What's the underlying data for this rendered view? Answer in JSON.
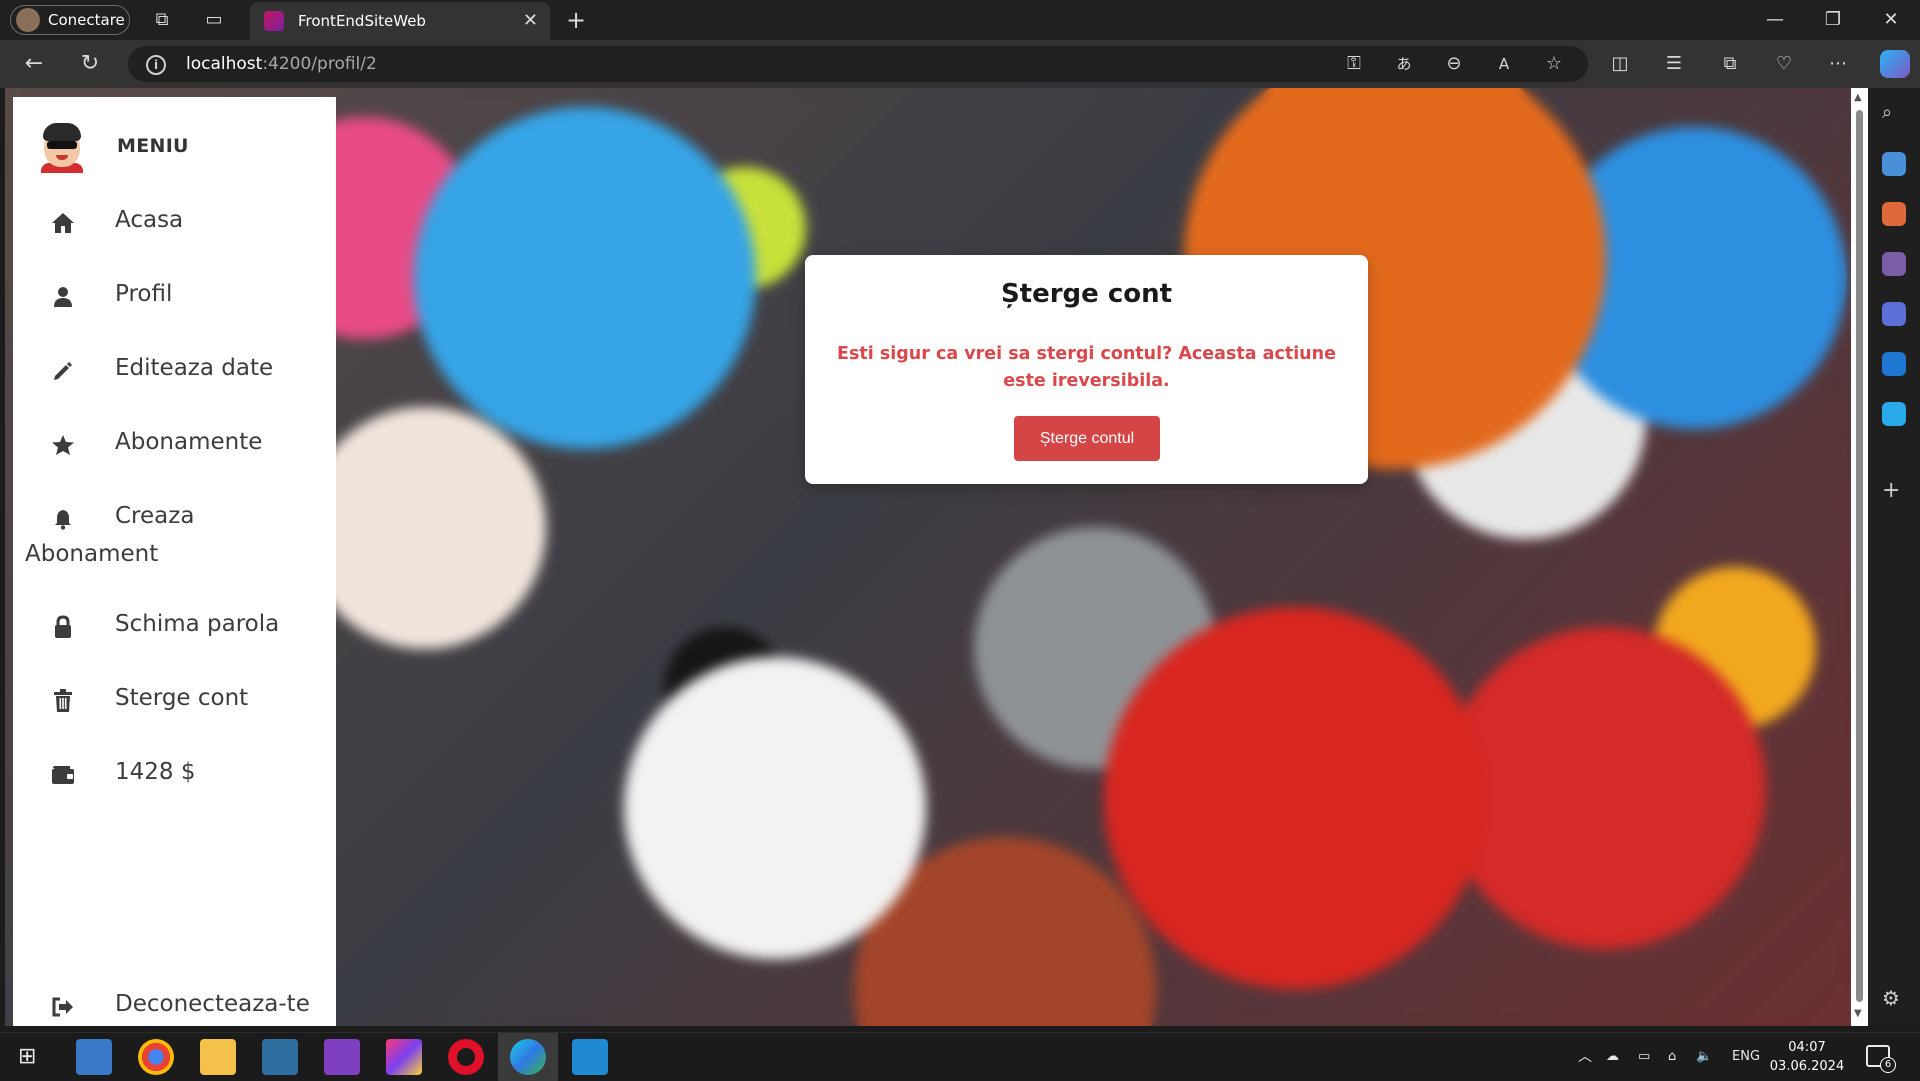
{
  "browser": {
    "profile_label": "Conectare",
    "tab_title": "FrontEndSiteWeb",
    "url_host": "localhost",
    "url_path": ":4200/profil/2"
  },
  "sidebar": {
    "title": "MENIU",
    "items": [
      {
        "label": "Acasa",
        "icon": "home-icon"
      },
      {
        "label": "Profil",
        "icon": "user-icon"
      },
      {
        "label": "Editeaza date",
        "icon": "pencil-icon"
      },
      {
        "label": "Abonamente",
        "icon": "star-icon"
      },
      {
        "label": "Creaza",
        "label2": "Abonament",
        "icon": "bell-icon"
      },
      {
        "label": "Schima parola",
        "icon": "lock-icon"
      },
      {
        "label": "Sterge cont",
        "icon": "trash-icon"
      },
      {
        "label": "1428 $",
        "icon": "wallet-icon"
      }
    ],
    "logout_label": "Deconecteaza-te"
  },
  "modal": {
    "title": "Șterge cont",
    "message": "Esti sigur ca vrei sa stergi contul? Aceasta actiune este ireversibila.",
    "button_label": "Șterge contul"
  },
  "taskbar": {
    "language": "ENG",
    "time": "04:07",
    "date": "03.06.2024",
    "notification_count": "6"
  },
  "colors": {
    "danger": "#d64545",
    "danger_text": "#d9484c",
    "sidebar_bg": "#ffffff"
  }
}
